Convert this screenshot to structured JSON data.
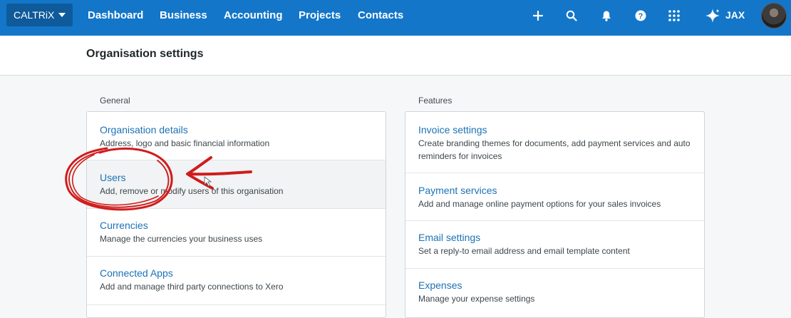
{
  "topbar": {
    "org_name": "CALTRiX",
    "nav": [
      "Dashboard",
      "Business",
      "Accounting",
      "Projects",
      "Contacts"
    ],
    "icons": [
      "plus-icon",
      "search-icon",
      "bell-icon",
      "help-icon",
      "apps-grid-icon",
      "sparkle-icon"
    ],
    "user_label": "JAX"
  },
  "page": {
    "title": "Organisation settings"
  },
  "general": {
    "label": "General",
    "items": [
      {
        "title": "Organisation details",
        "desc": "Address, logo and basic financial information"
      },
      {
        "title": "Users",
        "desc": "Add, remove or modify users of this organisation"
      },
      {
        "title": "Currencies",
        "desc": "Manage the currencies your business uses"
      },
      {
        "title": "Connected Apps",
        "desc": "Add and manage third party connections to Xero"
      }
    ]
  },
  "features": {
    "label": "Features",
    "items": [
      {
        "title": "Invoice settings",
        "desc": "Create branding themes for documents, add payment services and auto reminders for invoices"
      },
      {
        "title": "Payment services",
        "desc": "Add and manage online payment options for your sales invoices"
      },
      {
        "title": "Email settings",
        "desc": "Set a reply-to email address and email template content"
      },
      {
        "title": "Expenses",
        "desc": "Manage your expense settings"
      }
    ]
  },
  "colors": {
    "topbar": "#1376c9",
    "link": "#1c72b5",
    "annotation": "#d01c1c"
  }
}
